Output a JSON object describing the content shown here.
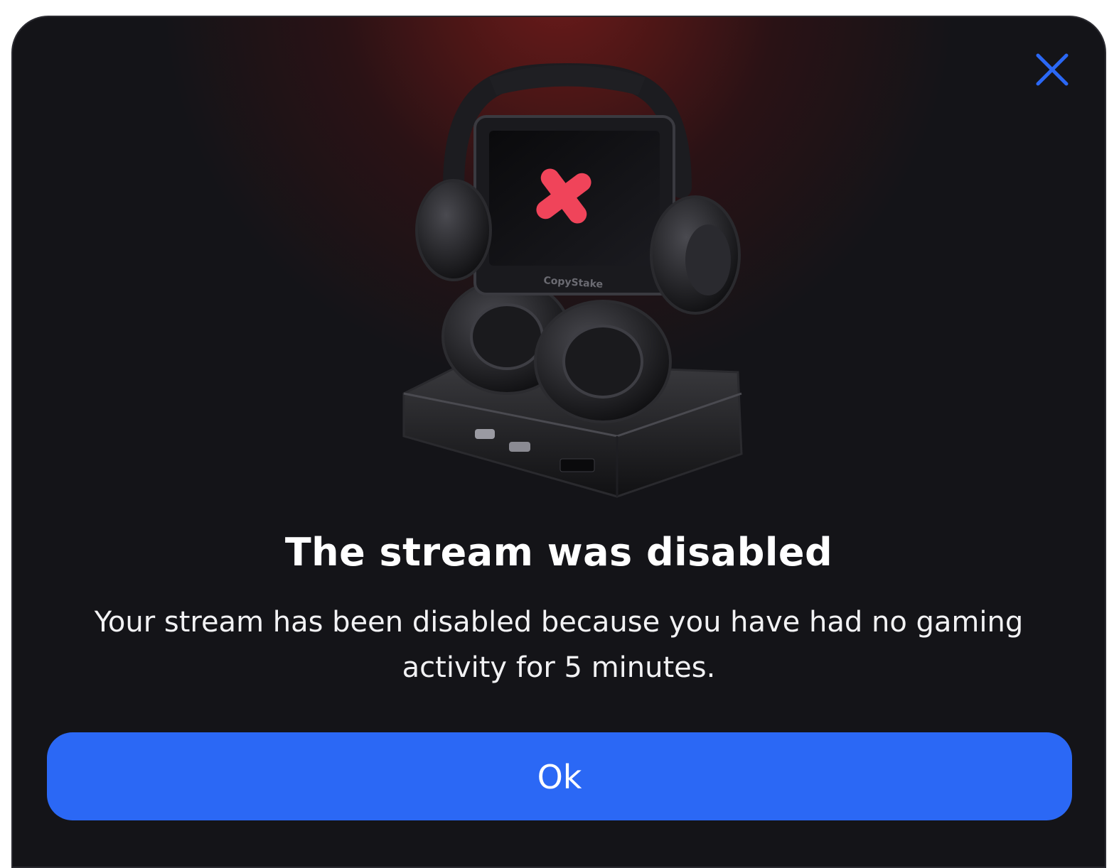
{
  "dialog": {
    "title": "The stream was disabled",
    "message": "Your stream has been disabled because you have had no gaming activity for 5 minutes.",
    "ok_label": "Ok",
    "close_icon": "close-icon",
    "illustration_icon": "streaming-device-disabled-icon",
    "illustration_brand": "CopyStake"
  },
  "colors": {
    "background": "#141418",
    "glow": "#6a1a1a",
    "accent": "#2b68f5",
    "close_icon": "#2b68f5",
    "error_mark": "#f0445a",
    "title": "#ffffff"
  }
}
